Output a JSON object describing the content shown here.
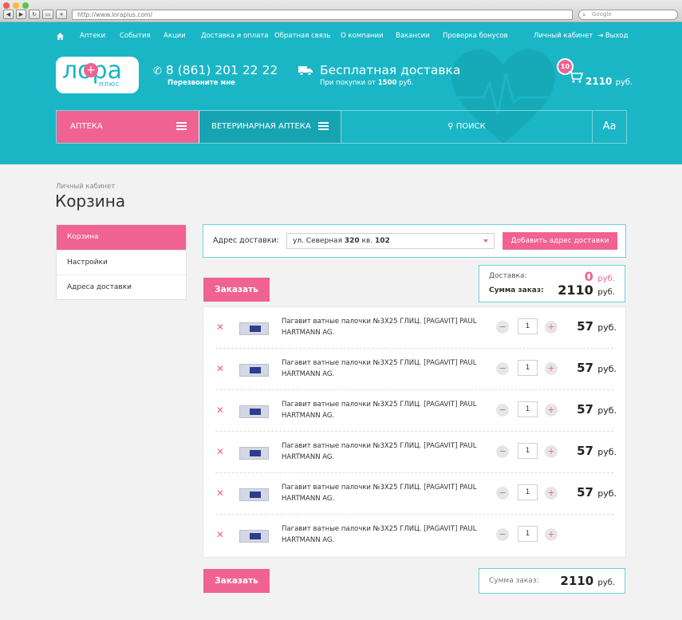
{
  "browser": {
    "url": "http://www.loraplus.com/",
    "search_placeholder": "Google"
  },
  "topnav": {
    "items": [
      "Аптеки",
      "События",
      "Акции",
      "Доставка и оплата",
      "Обратная связь",
      "О компании",
      "Вакансии",
      "Проверка бонусов"
    ],
    "account": "Личный кабинет",
    "logout": "Выход"
  },
  "logo": {
    "main": "лора",
    "sub": "плюс"
  },
  "contact": {
    "phone": "8 (861) 201 22 22",
    "callback": "Перезвоните мне"
  },
  "delivery": {
    "title": "Бесплатная доставка",
    "sub_prefix": "При покупки от",
    "sub_amount": "1500",
    "sub_suffix": "руб."
  },
  "cart": {
    "count": "10",
    "total": "2110",
    "currency": "руб."
  },
  "mainbar": {
    "pharmacy": "АПТЕКА",
    "vet": "ВЕТЕРИНАРНАЯ АПТЕКА",
    "search": "ПОИСК",
    "font": "Aa"
  },
  "breadcrumb": "Личный кабинет",
  "page_title": "Корзина",
  "sidemenu": {
    "items": [
      "Корзина",
      "Настройки",
      "Адреса доставки"
    ]
  },
  "address": {
    "label": "Адрес доставки:",
    "street": "ул. Северная",
    "house": "320",
    "apt_label": "кв.",
    "apt": "102",
    "add_button": "Добавить адрес доставки"
  },
  "order_button": "Заказать",
  "summary": {
    "delivery_label": "Доставка:",
    "delivery_value": "0",
    "order_label": "Сумма заказ:",
    "order_value": "2110",
    "currency": "руб."
  },
  "items": [
    {
      "name": "Пагавит  ватные палочки №3Х25 ГЛИЦ. [PAGAVIT] PAUL HARTMANN AG.",
      "qty": "1",
      "price": "57",
      "currency": "руб."
    },
    {
      "name": "Пагавит  ватные палочки №3Х25 ГЛИЦ. [PAGAVIT] PAUL HARTMANN AG.",
      "qty": "1",
      "price": "57",
      "currency": "руб."
    },
    {
      "name": "Пагавит  ватные палочки №3Х25 ГЛИЦ. [PAGAVIT] PAUL HARTMANN AG.",
      "qty": "1",
      "price": "57",
      "currency": "руб."
    },
    {
      "name": "Пагавит  ватные палочки №3Х25 ГЛИЦ. [PAGAVIT] PAUL HARTMANN AG.",
      "qty": "1",
      "price": "57",
      "currency": "руб."
    },
    {
      "name": "Пагавит  ватные палочки №3Х25 ГЛИЦ. [PAGAVIT] PAUL HARTMANN AG.",
      "qty": "1",
      "price": "57",
      "currency": "руб."
    },
    {
      "name": "Пагавит  ватные палочки №3Х25 ГЛИЦ. [PAGAVIT] PAUL HARTMANN AG.",
      "qty": "1",
      "price": "",
      "currency": ""
    }
  ],
  "footer_summary": {
    "label": "Сумма заказ:",
    "value": "2110",
    "currency": "руб."
  },
  "colors": {
    "brand": "#1ab6c6",
    "accent": "#f06292",
    "dark_teal": "#16a4b3"
  },
  "icons": [
    "home-icon",
    "phone-icon",
    "truck-icon",
    "cart-icon",
    "menu-icon",
    "search-icon",
    "close-icon",
    "minus-icon",
    "plus-icon",
    "logout-icon",
    "caret-down-icon",
    "heart-icon"
  ]
}
